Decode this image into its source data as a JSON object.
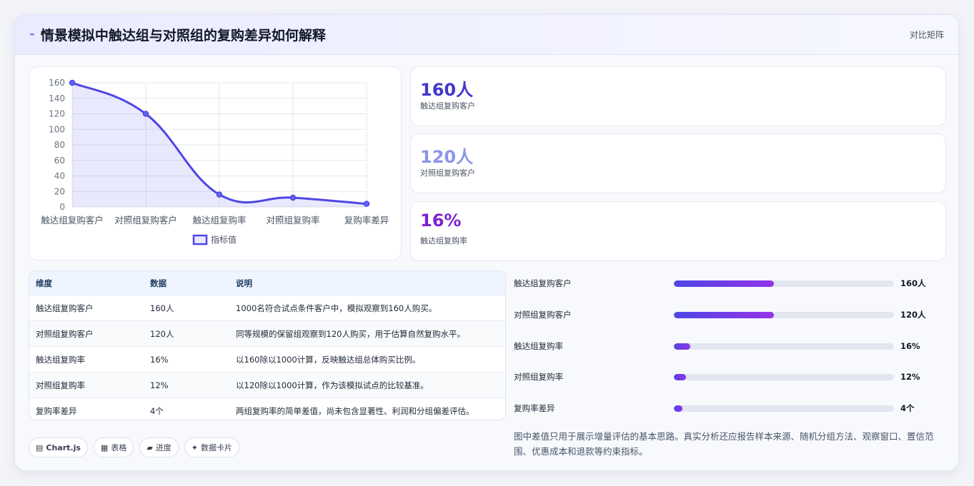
{
  "header": {
    "icon": "trend-icon",
    "title": "情景模拟中触达组与对照组的复购差异如何解释",
    "link": "对比矩阵"
  },
  "chart_data": {
    "type": "line",
    "categories": [
      "触达组复购客户",
      "对照组复购客户",
      "触达组复购率",
      "对照组复购率",
      "复购率差异"
    ],
    "series": [
      {
        "name": "指标值",
        "values": [
          160,
          120,
          16,
          12,
          4
        ]
      }
    ],
    "y_ticks": [
      "0",
      "20",
      "40",
      "60",
      "80",
      "100",
      "120",
      "140",
      "160"
    ],
    "ylim": [
      0,
      160
    ],
    "grid": true,
    "fill": true,
    "legend": "bottom",
    "color": "#4f46e5"
  },
  "stats": [
    {
      "value": "160人",
      "label": "触达组复购客户",
      "color": "#4338ca"
    },
    {
      "value": "120人",
      "label": "对照组复购客户",
      "color": "#8b95e8"
    },
    {
      "value": "16%",
      "label": "触达组复购率",
      "color": "#7e22ce"
    }
  ],
  "table": {
    "headers": [
      "维度",
      "数据",
      "说明"
    ],
    "rows": [
      [
        "触达组复购客户",
        "160人",
        "1000名符合试点条件客户中，模拟观察到160人购买。"
      ],
      [
        "对照组复购客户",
        "120人",
        "同等规模的保留组观察到120人购买，用于估算自然复购水平。"
      ],
      [
        "触达组复购率",
        "16%",
        "以160除以1000计算，反映触达组总体购买比例。"
      ],
      [
        "对照组复购率",
        "12%",
        "以120除以1000计算，作为该模拟试点的比较基准。"
      ],
      [
        "复购率差异",
        "4个",
        "两组复购率的简单差值，尚未包含显著性、利润和分组偏差评估。"
      ]
    ]
  },
  "progress": [
    {
      "label": "触达组复购客户",
      "value": "160人",
      "fraction": 0.455
    },
    {
      "label": "对照组复购客户",
      "value": "120人",
      "fraction": 0.455
    },
    {
      "label": "触达组复购率",
      "value": "16%",
      "fraction": 0.075
    },
    {
      "label": "对照组复购率",
      "value": "12%",
      "fraction": 0.055
    },
    {
      "label": "复购率差异",
      "value": "4个",
      "fraction": 0.038
    }
  ],
  "note": "图中差值只用于展示增量评估的基本思路。真实分析还应报告样本来源、随机分组方法、观察窗口、置信范围、优惠成本和退款等约束指标。",
  "chips": [
    {
      "icon": "chart-icon",
      "glyph": "▤",
      "label": "Chart.js"
    },
    {
      "icon": "table-icon",
      "glyph": "▦",
      "label": "表格"
    },
    {
      "icon": "progress-icon",
      "glyph": "▰",
      "label": "进度"
    },
    {
      "icon": "sparkle-icon",
      "glyph": "✦",
      "label": "数据卡片"
    }
  ]
}
